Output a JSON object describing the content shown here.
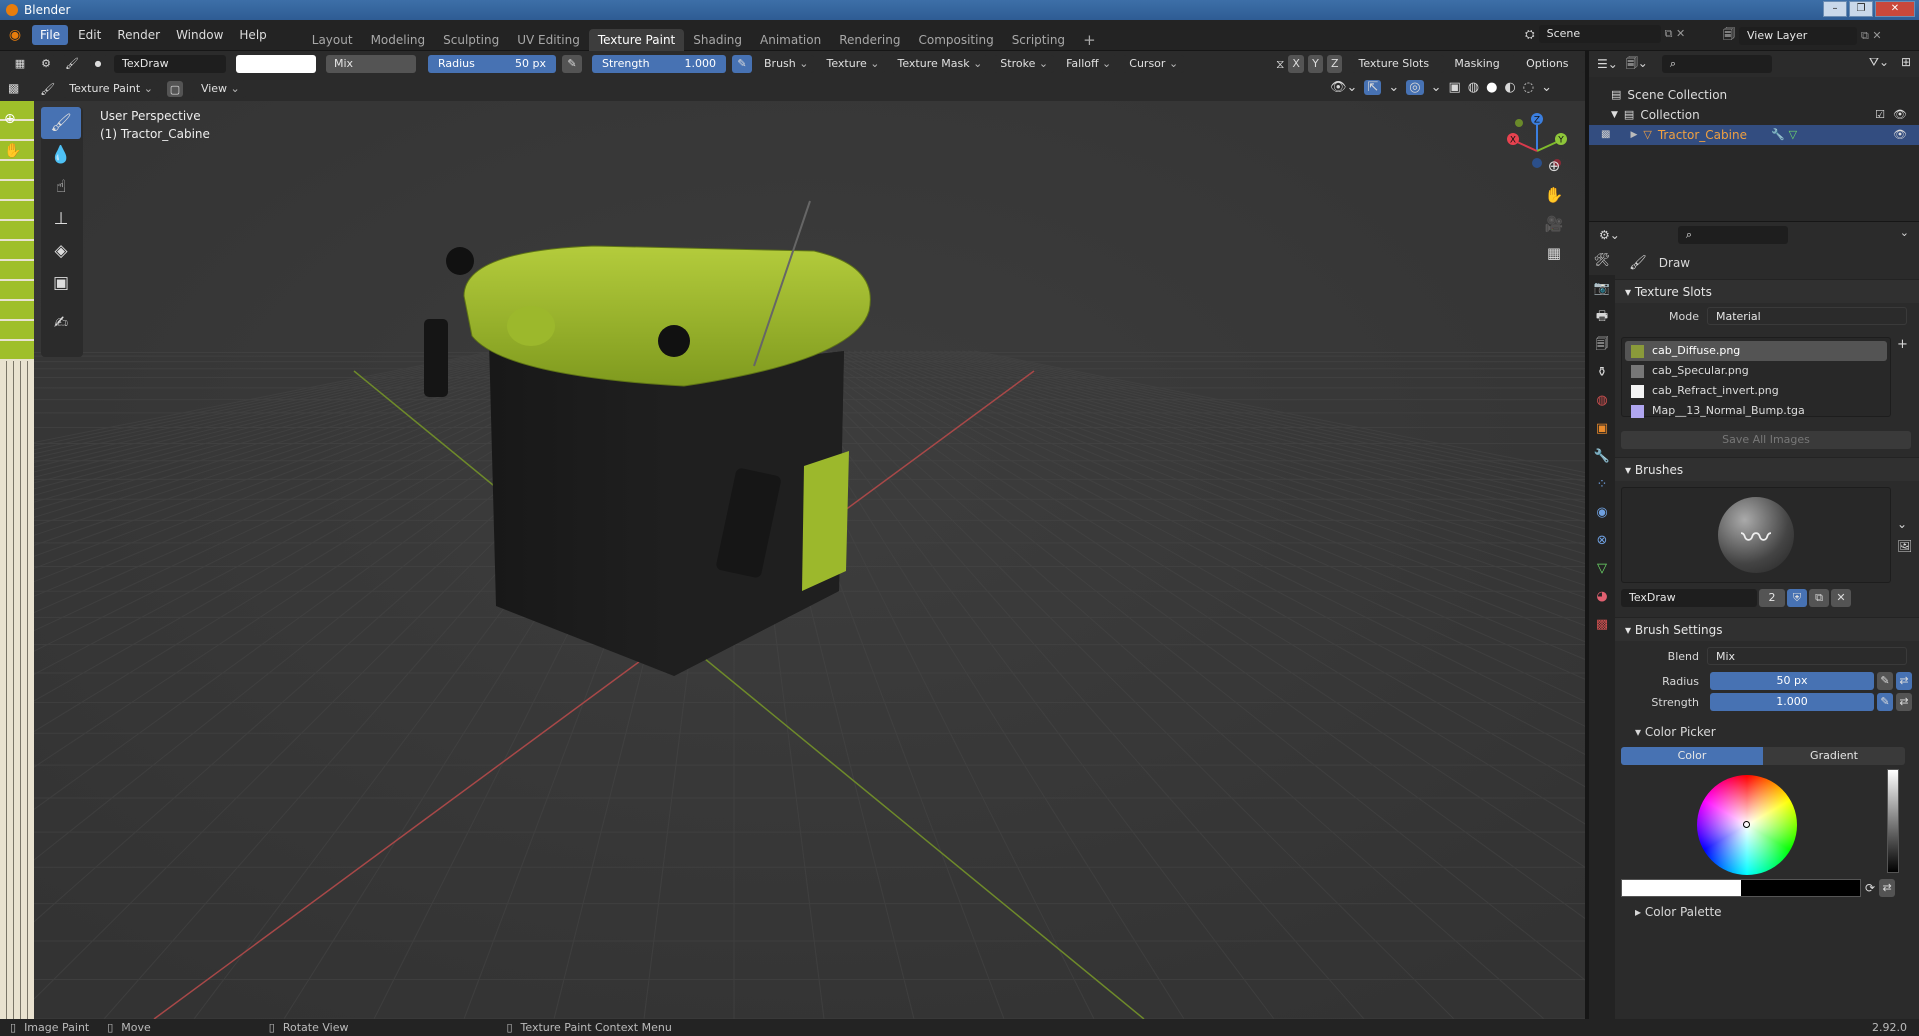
{
  "app": {
    "title": "Blender",
    "version": "2.92.0"
  },
  "menu": [
    "File",
    "Edit",
    "Render",
    "Window",
    "Help"
  ],
  "workspaces": [
    "Layout",
    "Modeling",
    "Sculpting",
    "UV Editing",
    "Texture Paint",
    "Shading",
    "Animation",
    "Rendering",
    "Compositing",
    "Scripting"
  ],
  "active_workspace": "Texture Paint",
  "top_right": {
    "scene": "Scene",
    "view_layer": "View Layer"
  },
  "tool_header": {
    "brush_name": "TexDraw",
    "blend": "Mix",
    "radius_label": "Radius",
    "radius_value": "50 px",
    "strength_label": "Strength",
    "strength_value": "1.000",
    "menus": [
      "Brush",
      "Texture",
      "Texture Mask",
      "Stroke",
      "Falloff",
      "Cursor"
    ],
    "axes": [
      "X",
      "Y",
      "Z"
    ],
    "right_menus": [
      "Texture Slots",
      "Masking",
      "Options"
    ]
  },
  "view_header": {
    "mode": "Texture Paint",
    "view_menu": "View"
  },
  "viewport": {
    "line1": "User Perspective",
    "line2": "(1) Tractor_Cabine"
  },
  "gizmo": {
    "z": "Z",
    "y": "Y",
    "x": "X"
  },
  "outliner": {
    "scene_collection": "Scene Collection",
    "collection": "Collection",
    "object": "Tractor_Cabine"
  },
  "properties": {
    "tool_name": "Draw",
    "texture_slots": {
      "title": "Texture Slots",
      "mode_label": "Mode",
      "mode_value": "Material",
      "slots": [
        {
          "name": "cab_Diffuse.png",
          "color": "#8a9a3a"
        },
        {
          "name": "cab_Specular.png",
          "color": "#777777"
        },
        {
          "name": "cab_Refract_invert.png",
          "color": "#f4f4f4"
        },
        {
          "name": "Map__13_Normal_Bump.tga",
          "color": "#b0a6f0"
        }
      ],
      "save_all": "Save All Images"
    },
    "brushes": {
      "title": "Brushes",
      "brush_name": "TexDraw",
      "users": "2"
    },
    "brush_settings": {
      "title": "Brush Settings",
      "blend_label": "Blend",
      "blend_value": "Mix",
      "radius_label": "Radius",
      "radius_value": "50 px",
      "strength_label": "Strength",
      "strength_value": "1.000"
    },
    "color_picker": {
      "title": "Color Picker",
      "tab_color": "Color",
      "tab_gradient": "Gradient"
    },
    "color_palette": {
      "title": "Color Palette"
    }
  },
  "statusbar": {
    "item1": "Image Paint",
    "item2": "Move",
    "item3": "Rotate View",
    "item4": "Texture Paint Context Menu"
  },
  "colors": {
    "accent": "#4772b3",
    "model_green": "#9cb82c",
    "selection_orange": "#f0a040"
  }
}
